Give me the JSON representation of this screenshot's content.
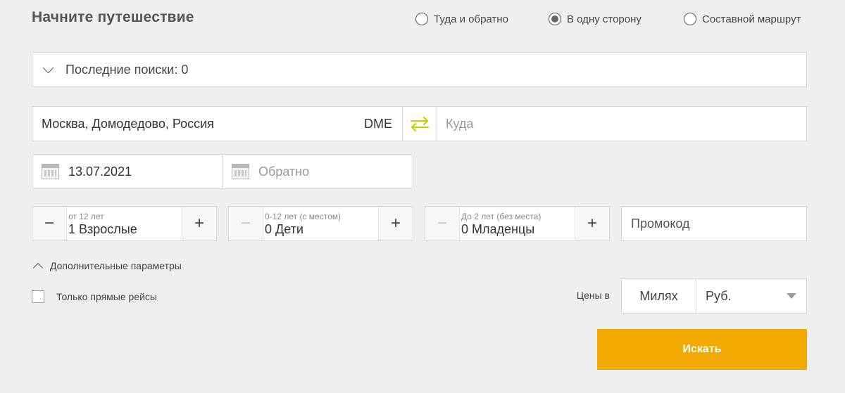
{
  "page": {
    "title": "Начните путешествие"
  },
  "trip_type": {
    "options": [
      {
        "label": "Туда и обратно",
        "selected": false
      },
      {
        "label": "В одну сторону",
        "selected": true
      },
      {
        "label": "Составной маршрут",
        "selected": false
      }
    ]
  },
  "recent_searches": {
    "label": "Последние поиски: 0"
  },
  "route": {
    "from_value": "Москва, Домодедово, Россия",
    "from_code": "DME",
    "to_value": "",
    "to_placeholder": "Куда",
    "swap_color": "#c6cf00"
  },
  "dates": {
    "depart_value": "13.07.2021",
    "return_placeholder": "Обратно"
  },
  "passengers": {
    "adults": {
      "sublabel": "от 12 лет",
      "value": "1 Взрослые",
      "minus_enabled": true
    },
    "children": {
      "sublabel": "0-12 лет (с местом)",
      "value": "0 Дети",
      "minus_enabled": false
    },
    "infants": {
      "sublabel": "До 2 лет (без места)",
      "value": "0 Младенцы",
      "minus_enabled": false
    },
    "minus_symbol": "−",
    "plus_symbol": "+"
  },
  "promo": {
    "placeholder": "Промокод"
  },
  "extra_params": {
    "label": "Дополнительные параметры"
  },
  "direct_flights": {
    "label": "Только прямые рейсы",
    "checked": false
  },
  "prices": {
    "label": "Цены в",
    "miles_label": "Милях",
    "currency_value": "Руб."
  },
  "search": {
    "label": "Искать",
    "color": "#f2a900"
  }
}
